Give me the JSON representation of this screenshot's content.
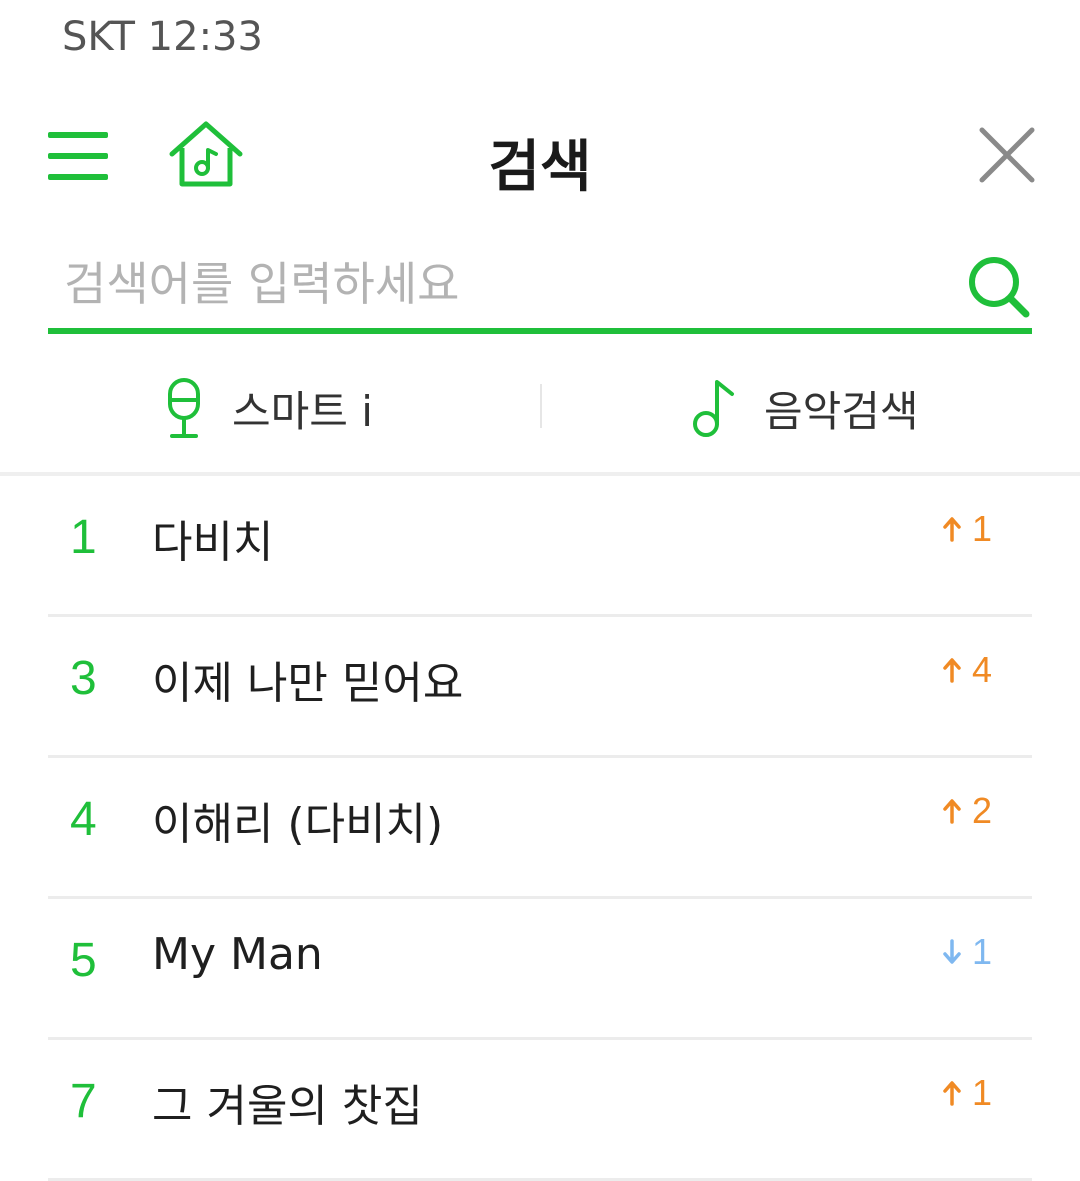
{
  "status_bar": {
    "carrier": "SKT",
    "time": "12:33"
  },
  "header": {
    "title": "검색"
  },
  "search": {
    "placeholder": "검색어를 입력하세요",
    "value": ""
  },
  "modes": [
    {
      "label": "스마트 i",
      "icon": "microphone-icon"
    },
    {
      "label": "음악검색",
      "icon": "music-note-icon"
    }
  ],
  "rankings": [
    {
      "rank": "1",
      "keyword": "다비치",
      "change": "1",
      "direction": "up"
    },
    {
      "rank": "3",
      "keyword": "이제 나만 믿어요",
      "change": "4",
      "direction": "up"
    },
    {
      "rank": "4",
      "keyword": "이해리 (다비치)",
      "change": "2",
      "direction": "up"
    },
    {
      "rank": "5",
      "keyword": "My Man",
      "change": "1",
      "direction": "down"
    },
    {
      "rank": "7",
      "keyword": "그 겨울의 찻집",
      "change": "1",
      "direction": "up"
    }
  ],
  "colors": {
    "accent": "#1fbf3a",
    "rank_up": "#f08a24",
    "rank_down": "#7fb8f0"
  }
}
